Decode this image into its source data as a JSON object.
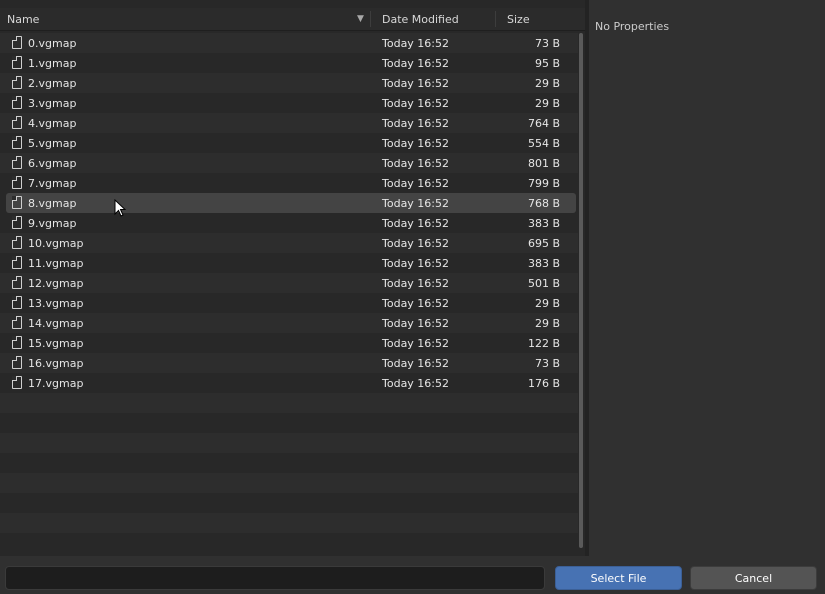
{
  "header": {
    "name_label": "Name",
    "date_label": "Date Modified",
    "size_label": "Size",
    "sort_icon": "triangle-down-icon"
  },
  "files": [
    {
      "name": "0.vgmap",
      "date": "Today 16:52",
      "size": "73 B"
    },
    {
      "name": "1.vgmap",
      "date": "Today 16:52",
      "size": "95 B"
    },
    {
      "name": "2.vgmap",
      "date": "Today 16:52",
      "size": "29 B"
    },
    {
      "name": "3.vgmap",
      "date": "Today 16:52",
      "size": "29 B"
    },
    {
      "name": "4.vgmap",
      "date": "Today 16:52",
      "size": "764 B"
    },
    {
      "name": "5.vgmap",
      "date": "Today 16:52",
      "size": "554 B"
    },
    {
      "name": "6.vgmap",
      "date": "Today 16:52",
      "size": "801 B"
    },
    {
      "name": "7.vgmap",
      "date": "Today 16:52",
      "size": "799 B"
    },
    {
      "name": "8.vgmap",
      "date": "Today 16:52",
      "size": "768 B",
      "selected": true
    },
    {
      "name": "9.vgmap",
      "date": "Today 16:52",
      "size": "383 B"
    },
    {
      "name": "10.vgmap",
      "date": "Today 16:52",
      "size": "695 B"
    },
    {
      "name": "11.vgmap",
      "date": "Today 16:52",
      "size": "383 B"
    },
    {
      "name": "12.vgmap",
      "date": "Today 16:52",
      "size": "501 B"
    },
    {
      "name": "13.vgmap",
      "date": "Today 16:52",
      "size": "29 B"
    },
    {
      "name": "14.vgmap",
      "date": "Today 16:52",
      "size": "29 B"
    },
    {
      "name": "15.vgmap",
      "date": "Today 16:52",
      "size": "122 B"
    },
    {
      "name": "16.vgmap",
      "date": "Today 16:52",
      "size": "73 B"
    },
    {
      "name": "17.vgmap",
      "date": "Today 16:52",
      "size": "176 B"
    }
  ],
  "properties": {
    "empty_label": "No Properties"
  },
  "footer": {
    "filename_value": "",
    "select_label": "Select File",
    "cancel_label": "Cancel"
  },
  "colors": {
    "accent": "#4772b3",
    "selected_row": "#444444"
  }
}
